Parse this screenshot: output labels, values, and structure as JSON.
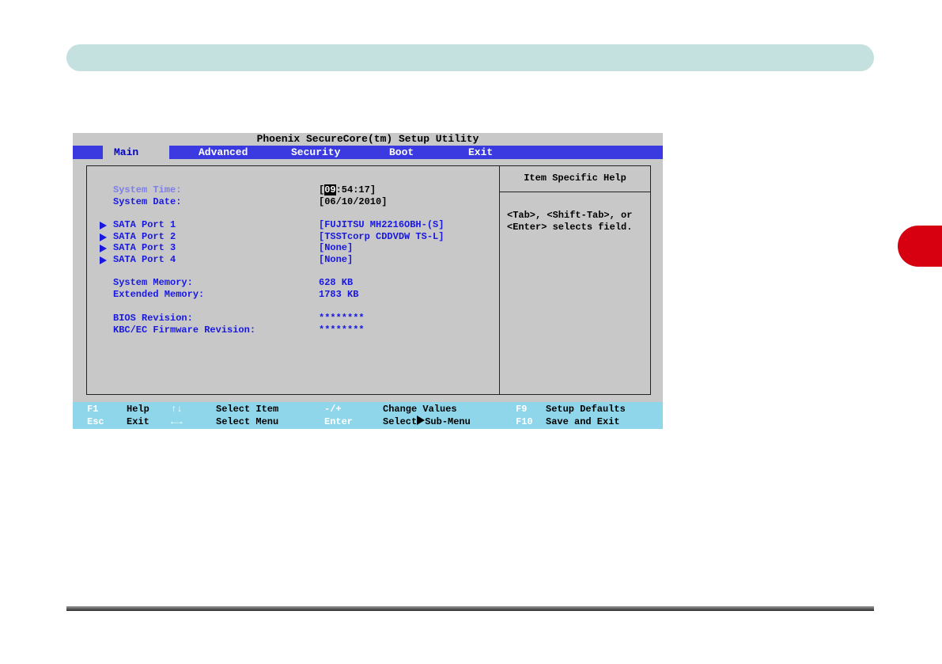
{
  "bios": {
    "title": "Phoenix SecureCore(tm) Setup Utility",
    "menu": [
      "Main",
      "Advanced",
      "Security",
      "Boot",
      "Exit"
    ],
    "active_menu": "Main",
    "help": {
      "title": "Item Specific Help",
      "line1": "<Tab>, <Shift-Tab>, or",
      "line2": "<Enter> selects field."
    },
    "fields": {
      "system_time_label": "System Time:",
      "system_time_value_prefix": "[",
      "system_time_hour": "09",
      "system_time_value_rest": ":54:17]",
      "system_date_label": "System Date:",
      "system_date_value": "[06/10/2010]",
      "sata1_label": "SATA Port 1",
      "sata1_value": "[FUJITSU MH2216OBH-(S]",
      "sata2_label": "SATA Port 2",
      "sata2_value": "[TSSTcorp CDDVDW TS-L]",
      "sata3_label": "SATA Port 3",
      "sata3_value": "[None]",
      "sata4_label": "SATA Port 4",
      "sata4_value": "[None]",
      "system_memory_label": "System Memory:",
      "system_memory_value": "628 KB",
      "extended_memory_label": "Extended Memory:",
      "extended_memory_value": "1783 KB",
      "bios_revision_label": "BIOS Revision:",
      "bios_revision_value": "********",
      "kbc_revision_label": "KBC/EC Firmware Revision:",
      "kbc_revision_value": "********"
    },
    "footer": {
      "row1": {
        "k1": "F1",
        "d1": "Help",
        "k2": "↑↓",
        "d2": "Select Item",
        "k3": "-/+",
        "d3": "Change Values",
        "k4": "F9",
        "d4": "Setup Defaults"
      },
      "row2": {
        "k1": "Esc",
        "d1": "Exit",
        "k2": "←→",
        "d2": "Select Menu",
        "k3": "Enter",
        "d3a": "Select",
        "d3b": "Sub-Menu",
        "k4": "F10",
        "d4": "Save and Exit"
      }
    }
  },
  "colors": {
    "menu_bar": "#3a3ae0",
    "bios_bg": "#c8c8c8",
    "footer_bg": "#8fd6ea",
    "chapter_tab": "#d60010",
    "top_band": "#c4e0df"
  }
}
